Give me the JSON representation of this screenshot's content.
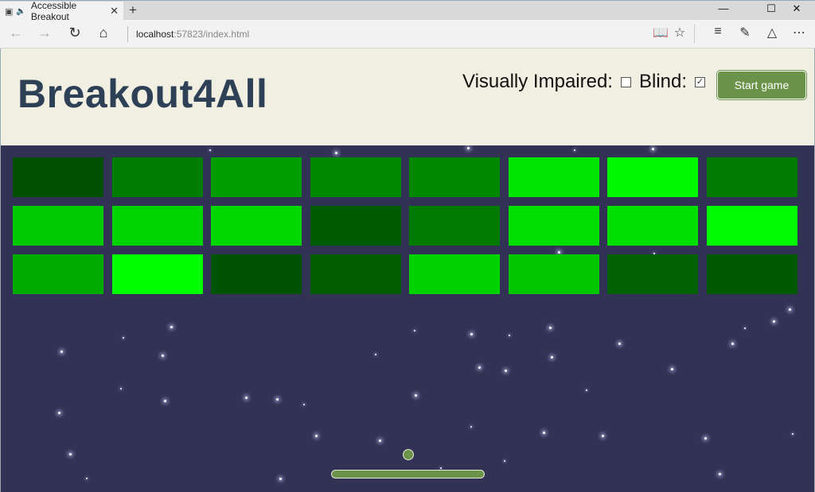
{
  "browser": {
    "tab_title": "Accessible Breakout",
    "address_host": "localhost",
    "address_rest": ":57823/index.html"
  },
  "header": {
    "title": "Breakout4All",
    "visually_impaired_label": "Visually Impaired:",
    "visually_impaired_checked": false,
    "blind_label": "Blind:",
    "blind_checked": true,
    "start_button": "Start game"
  },
  "game": {
    "bricks": [
      [
        "#004e00",
        "#007c00",
        "#009e00",
        "#008900",
        "#008700",
        "#00e600",
        "#00f800",
        "#007b00"
      ],
      [
        "#00ca00",
        "#00d400",
        "#00d600",
        "#005c00",
        "#007a00",
        "#00df00",
        "#00e000",
        "#00fa00"
      ],
      [
        "#00ac00",
        "#00fd00",
        "#005300",
        "#005d00",
        "#00d200",
        "#00c700",
        "#006200",
        "#005800"
      ]
    ],
    "accent_color": "#6b9349",
    "background_color": "#323254"
  }
}
